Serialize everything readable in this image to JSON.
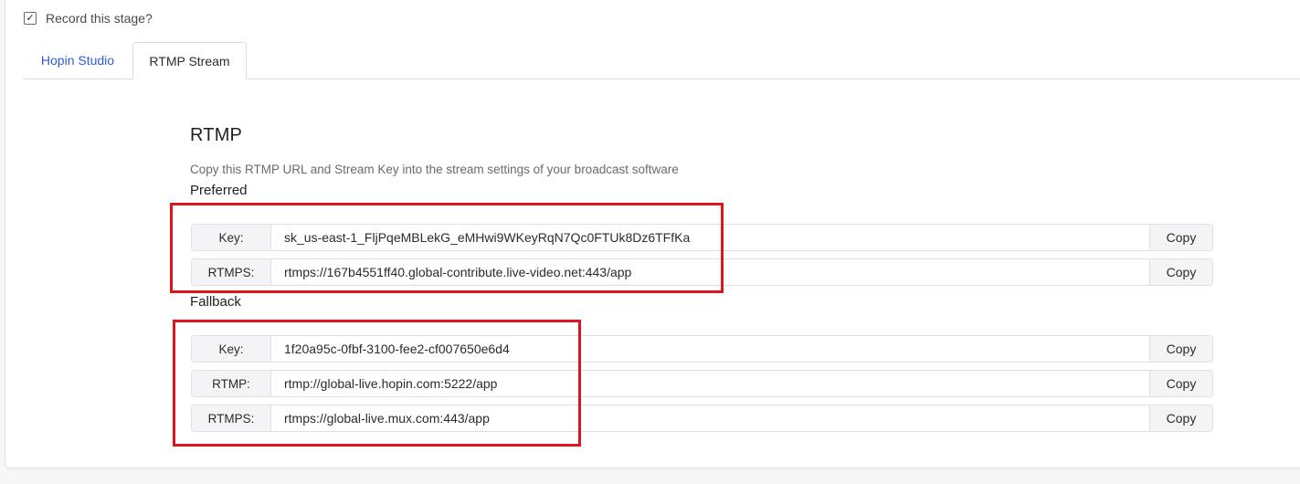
{
  "record": {
    "label": "Record this stage?",
    "checked_glyph": "✓"
  },
  "tabs": [
    {
      "label": "Hopin Studio",
      "active": false
    },
    {
      "label": "RTMP Stream",
      "active": true
    }
  ],
  "rtmp": {
    "title": "RTMP",
    "description": "Copy this RTMP URL and Stream Key into the stream settings of your broadcast software",
    "preferred": {
      "heading": "Preferred",
      "rows": [
        {
          "label": "Key:",
          "value": "sk_us-east-1_FljPqeMBLekG_eMHwi9WKeyRqN7Qc0FTUk8Dz6TFfKa",
          "copy": "Copy"
        },
        {
          "label": "RTMPS:",
          "value": "rtmps://167b4551ff40.global-contribute.live-video.net:443/app",
          "copy": "Copy"
        }
      ]
    },
    "fallback": {
      "heading": "Fallback",
      "rows": [
        {
          "label": "Key:",
          "value": "1f20a95c-0fbf-3100-fee2-cf007650e6d4",
          "copy": "Copy"
        },
        {
          "label": "RTMP:",
          "value": "rtmp://global-live.hopin.com:5222/app",
          "copy": "Copy"
        },
        {
          "label": "RTMPS:",
          "value": "rtmps://global-live.mux.com:443/app",
          "copy": "Copy"
        }
      ]
    }
  },
  "colors": {
    "accent": "#2e5bd9",
    "highlight": "#e0141c",
    "label_bg": "#f4f4f6",
    "border": "#e0e0e4"
  }
}
